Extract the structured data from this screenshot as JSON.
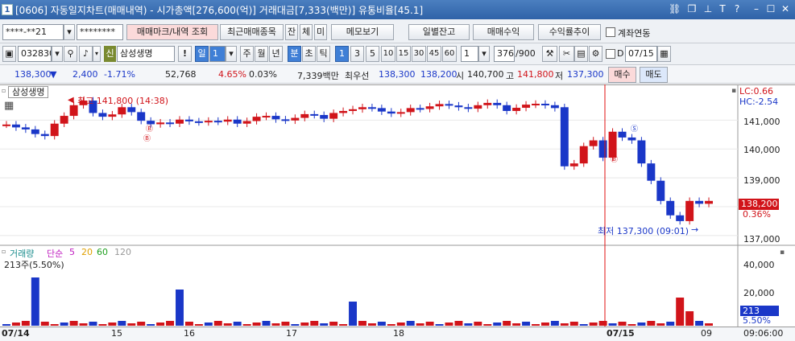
{
  "window": {
    "number": "1",
    "title": "[0606] 자동일지차트(매매내역) - 시가총액[276,600(억)] 거래대금[7,333(백만)] 유통비율[45.1]"
  },
  "toolbar1": {
    "account": "****-**21",
    "password": "********",
    "btn_trade_mark": "매매마크/내역 조회",
    "btn_recent": "최근매매종목",
    "btn_jan": "잔",
    "btn_che": "체",
    "btn_mi": "미",
    "btn_memo": "메모보기",
    "btn_daily": "일별잔고",
    "btn_trade_profit": "매매수익",
    "btn_yield": "수익률추이",
    "link_label": "계좌연동"
  },
  "toolbar2": {
    "code": "032830",
    "stock_name": "삼성생명",
    "shin": "신",
    "period_sel": "일",
    "period_n": "1",
    "periods": [
      "주",
      "월",
      "년",
      "분",
      "초",
      "틱"
    ],
    "minutes": [
      "1",
      "3",
      "5",
      "10",
      "15",
      "30",
      "45",
      "60"
    ],
    "count_sel": "1",
    "count": "376",
    "count_total": "/900",
    "d_label": "D",
    "date": "07/15"
  },
  "quote": {
    "price": "138,300",
    "change": "2,400",
    "change_pct": "-1.71%",
    "volume": "52,768",
    "vol_ratio": "4.65%",
    "turnover": "0.03%",
    "amount": "7,339백만",
    "best_ask_label": "최우선",
    "best_ask": "138,300",
    "best_bid": "138,200",
    "open_label": "시",
    "open": "140,700",
    "high_label": "고",
    "high": "141,800",
    "low_label": "저",
    "low": "137,300",
    "buy": "매수",
    "sell": "매도"
  },
  "chart": {
    "stock_label": "삼성생명",
    "lc": "LC:0.66",
    "hc": "HC:-2.54",
    "max_annot": "최고 141,800 (14:38)",
    "min_annot": "최저 137,300 (09:01)",
    "y_ticks": [
      "141,000",
      "140,000",
      "139,000",
      "138,000",
      "137,000"
    ],
    "cur_price": "138,200",
    "cur_pct": "0.36%"
  },
  "volume": {
    "legend_title": "거래량",
    "legend_type": "단순",
    "ma": [
      "5",
      "20",
      "60",
      "120"
    ],
    "value": "213주(5.50%)",
    "y_ticks": [
      "40,000",
      "20,000"
    ],
    "cur": "213",
    "cur_pct": "5.50%"
  },
  "xaxis": {
    "labels": [
      "07/14",
      "15",
      "16",
      "17",
      "18",
      "07/15",
      "09"
    ],
    "time": "09:06:00"
  },
  "colors": {
    "up": "#d1141a",
    "down": "#1a37c8",
    "vline": "#e01010",
    "ma5": "#c020c0",
    "ma20": "#e0a000",
    "ma60": "#20a020",
    "ma120": "#999999"
  },
  "chart_data": {
    "type": "candlestick",
    "x": [
      "07/14",
      "15",
      "16",
      "17",
      "18",
      "07/15",
      "09"
    ],
    "y_range": [
      136800,
      142100
    ],
    "series": [
      {
        "values": [
          140850,
          140750,
          140680,
          140520,
          140450,
          140880,
          141150,
          141520,
          141680,
          141250,
          141120,
          141200,
          141450,
          141280,
          140980,
          140860,
          140920,
          140880,
          141020,
          140960,
          140930,
          140980,
          140950,
          141020,
          140880,
          140970,
          141120,
          141150,
          141030,
          140990,
          141080,
          141210,
          141180,
          141050,
          141250,
          141320,
          141380,
          141450,
          141420,
          141300,
          141230,
          141280,
          141420,
          141390,
          141480,
          141560,
          141510,
          141450,
          141400,
          141520,
          141600,
          141520,
          141320,
          141430,
          141540,
          141570,
          141520,
          141420,
          139400,
          139500,
          140100,
          140300,
          139700,
          140600,
          140400,
          140300,
          139500,
          138900,
          138200,
          137700,
          137500,
          138200,
          138100,
          138200
        ]
      }
    ]
  }
}
